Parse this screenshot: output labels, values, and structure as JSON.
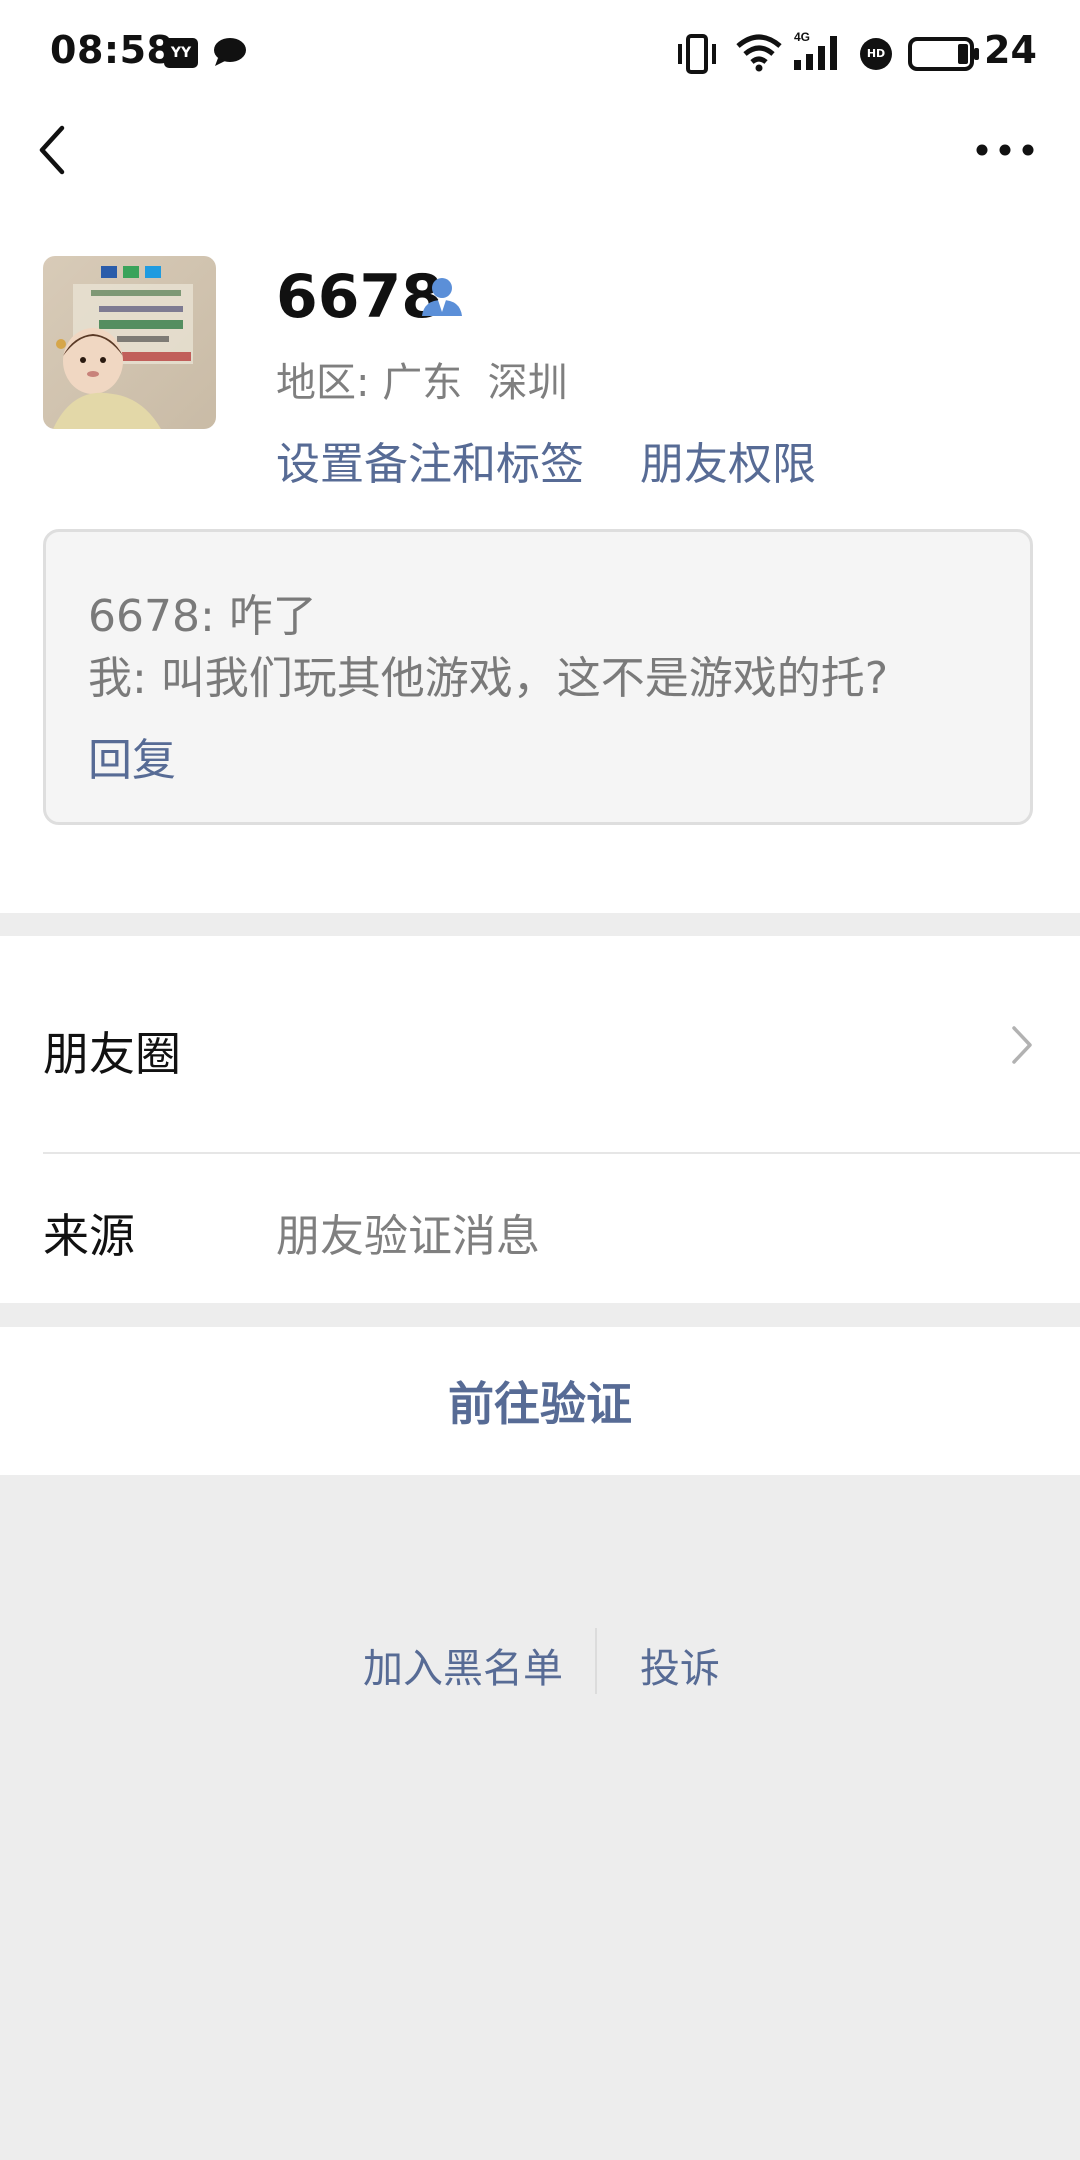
{
  "status_bar": {
    "time": "08:58",
    "battery_percent": "24",
    "app_badge": "YY",
    "hd_badge": "HD",
    "network": "4G",
    "icons": [
      "yy-app-icon",
      "chat-bubble-icon",
      "vibrate-icon",
      "wifi-icon",
      "signal-4g-icon",
      "hd-icon",
      "battery-icon"
    ]
  },
  "nav": {
    "back_icon": "chevron-left-icon",
    "more_icon": "more-dots-icon"
  },
  "profile": {
    "name": "6678",
    "region": "地区: 广东  深圳",
    "remark_link": "设置备注和标签",
    "permission_link": "朋友权限"
  },
  "message_card": {
    "line1": "6678: 咋了",
    "line2": "我: 叫我们玩其他游戏，这不是游戏的托?",
    "reply": "回复"
  },
  "list": {
    "moments_label": "朋友圈",
    "source_label": "来源",
    "source_value": "朋友验证消息"
  },
  "verify_button": "前往验证",
  "bottom": {
    "block_label": "加入黑名单",
    "report_label": "投诉"
  },
  "colors": {
    "link": "#576b95",
    "background": "#ededed",
    "card_bg": "#f5f5f5",
    "card_border": "#dedede",
    "person_icon": "#5b8fd8"
  }
}
